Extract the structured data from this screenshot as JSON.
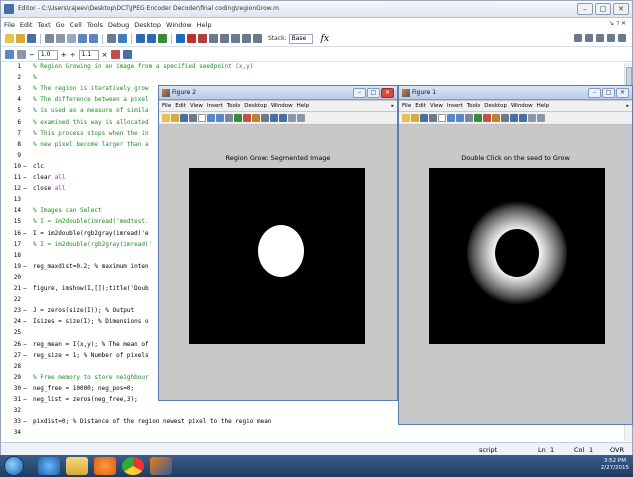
{
  "editor": {
    "title": "Editor - C:\\Users\\rajeev\\Desktop\\DCT\\JPEG Encoder Decoder\\final coding\\regionGrow.m",
    "menus": [
      "File",
      "Edit",
      "Text",
      "Go",
      "Cell",
      "Tools",
      "Debug",
      "Desktop",
      "Window",
      "Help"
    ],
    "menu_right": "↘ ⁊ ✕",
    "toolbar": {
      "stack_label": "Stack:",
      "stack_value": "Base",
      "fx": "fx"
    },
    "cellbar": {
      "minus": "−",
      "value1": "1.0",
      "plus": "+",
      "div": "÷",
      "value2": "1.1",
      "times": "×"
    },
    "code_lines": [
      {
        "n": "1",
        "dash": "",
        "text": "% Region Growing in an image from a specified seedpoint (x,y)",
        "type": "comment"
      },
      {
        "n": "2",
        "dash": "",
        "text": "%",
        "type": "comment"
      },
      {
        "n": "3",
        "dash": "",
        "text": "% The region is iteratively grow",
        "type": "comment"
      },
      {
        "n": "4",
        "dash": "",
        "text": "% The difference between a pixel",
        "type": "comment"
      },
      {
        "n": "5",
        "dash": "",
        "text": "% is used as a measure of simila",
        "type": "comment"
      },
      {
        "n": "6",
        "dash": "",
        "text": "% examined this way is allocated",
        "type": "comment"
      },
      {
        "n": "7",
        "dash": "",
        "text": "% This process stops when the in",
        "type": "comment"
      },
      {
        "n": "8",
        "dash": "",
        "text": "% new pixel become larger than a",
        "type": "comment"
      },
      {
        "n": "9",
        "dash": "",
        "text": "",
        "type": "code"
      },
      {
        "n": "10",
        "dash": "−",
        "text": "clc",
        "type": "code"
      },
      {
        "n": "11",
        "dash": "−",
        "text": "clear all",
        "type": "kwline",
        "kw": "all",
        "pre": "clear "
      },
      {
        "n": "12",
        "dash": "−",
        "text": "close all",
        "type": "kwline",
        "kw": "all",
        "pre": "close "
      },
      {
        "n": "13",
        "dash": "",
        "text": "",
        "type": "code"
      },
      {
        "n": "14",
        "dash": "",
        "text": "% Images can Select",
        "type": "comment"
      },
      {
        "n": "15",
        "dash": "",
        "text": "% I = im2double(imread('medtest.",
        "type": "comment"
      },
      {
        "n": "16",
        "dash": "−",
        "text": "I = im2double(rgb2gray(imread('e",
        "type": "code"
      },
      {
        "n": "17",
        "dash": "",
        "text": "% I = im2double(rgb2gray(imread('",
        "type": "comment"
      },
      {
        "n": "18",
        "dash": "",
        "text": "",
        "type": "code"
      },
      {
        "n": "19",
        "dash": "−",
        "text": "reg_maxdist=0.2; % maximum inten",
        "type": "code"
      },
      {
        "n": "20",
        "dash": "",
        "text": "",
        "type": "code"
      },
      {
        "n": "21",
        "dash": "−",
        "text": "figure, imshow(I,[]);title('Doub",
        "type": "code"
      },
      {
        "n": "22",
        "dash": "",
        "text": "",
        "type": "code"
      },
      {
        "n": "23",
        "dash": "−",
        "text": "J = zeros(size(I)); % Output",
        "type": "code"
      },
      {
        "n": "24",
        "dash": "−",
        "text": "Isizes = size(I); % Dimensions o",
        "type": "code"
      },
      {
        "n": "25",
        "dash": "",
        "text": "",
        "type": "code"
      },
      {
        "n": "26",
        "dash": "−",
        "text": "reg_mean = I(x,y); % The mean of",
        "type": "code"
      },
      {
        "n": "27",
        "dash": "−",
        "text": "reg_size = 1; % Number of pixels",
        "type": "code"
      },
      {
        "n": "28",
        "dash": "",
        "text": "",
        "type": "code"
      },
      {
        "n": "29",
        "dash": "",
        "text": "% Free memory to store neighbour",
        "type": "comment"
      },
      {
        "n": "30",
        "dash": "−",
        "text": "neg_free = 10000; neg_pos=0;",
        "type": "code"
      },
      {
        "n": "31",
        "dash": "−",
        "text": "neg_list = zeros(neg_free,3);",
        "type": "code"
      },
      {
        "n": "32",
        "dash": "",
        "text": "",
        "type": "code"
      },
      {
        "n": "33",
        "dash": "−",
        "text": "pixdist=0; % Distance of the region newest pixel to the regio mean",
        "type": "code"
      },
      {
        "n": "34",
        "dash": "",
        "text": "",
        "type": "code"
      }
    ],
    "status": {
      "mode": "script",
      "ln_label": "Ln",
      "ln": "1",
      "col_label": "Col",
      "col": "1",
      "ovr": "OVR"
    }
  },
  "figure2": {
    "title": "Figure 2",
    "menus": [
      "File",
      "Edit",
      "View",
      "Insert",
      "Tools",
      "Desktop",
      "Window",
      "Help"
    ],
    "heading": "Region Grow: Segmented Image"
  },
  "figure1": {
    "title": "Figure 1",
    "menus": [
      "File",
      "Edit",
      "View",
      "Insert",
      "Tools",
      "Desktop",
      "Window",
      "Help"
    ],
    "heading": "Double Click on the seed to Grow"
  },
  "taskbar": {
    "time": "3:52 PM",
    "date": "2/27/2015"
  }
}
